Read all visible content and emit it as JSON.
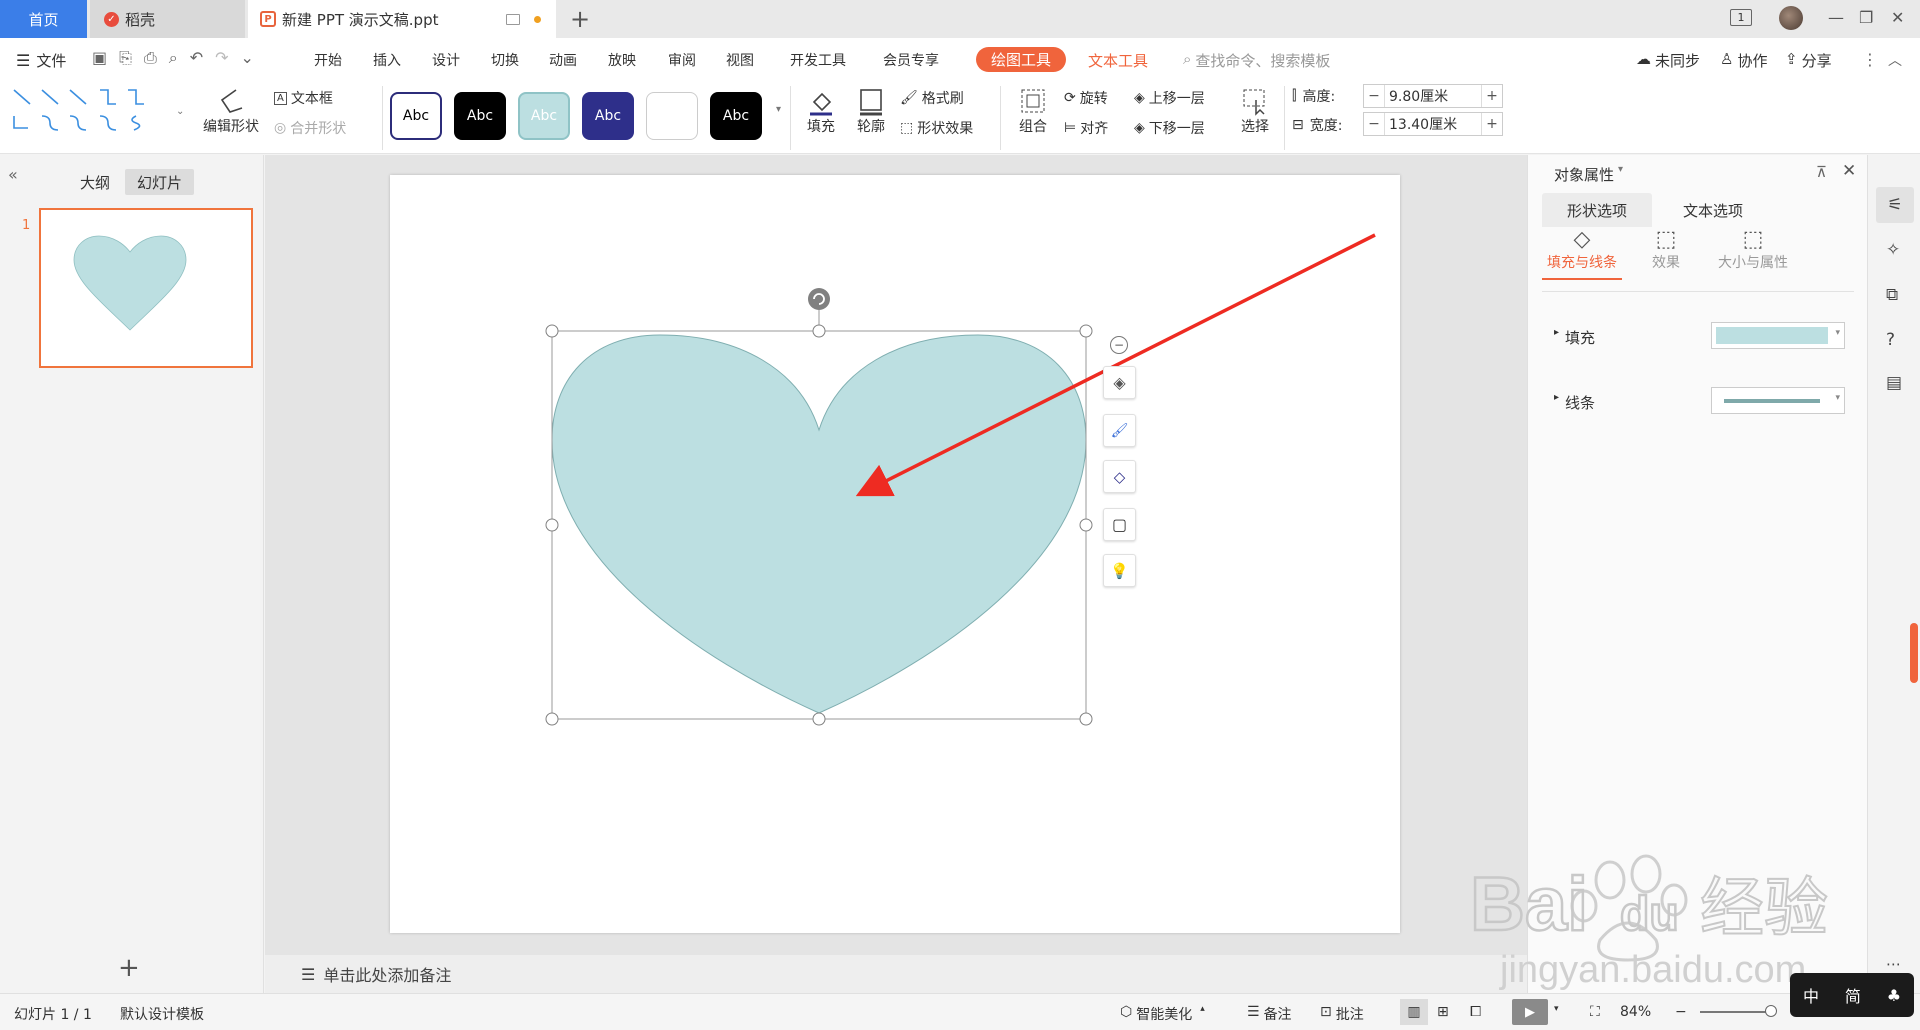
{
  "titlebar": {
    "home_tab": "首页",
    "docer_tab": "稻壳",
    "doc_tab": "新建 PPT 演示文稿.ppt",
    "add_tab": "+",
    "page_badge": "1"
  },
  "menubar": {
    "file": "文件",
    "items": [
      "开始",
      "插入",
      "设计",
      "切换",
      "动画",
      "放映",
      "审阅",
      "视图",
      "开发工具",
      "会员专享"
    ],
    "drawing_tools": "绘图工具",
    "text_tools": "文本工具",
    "search_placeholder": "查找命令、搜索模板",
    "sync": "未同步",
    "collab": "协作",
    "share": "分享"
  },
  "ribbon": {
    "edit_shape": "编辑形状",
    "text_box": "文本框",
    "merge_shape": "合并形状",
    "style_label": "Abc",
    "fill": "填充",
    "outline": "轮廓",
    "format_painter": "格式刷",
    "shape_effect": "形状效果",
    "group": "组合",
    "rotate": "旋转",
    "align": "对齐",
    "bring_forward": "上移一层",
    "send_backward": "下移一层",
    "select": "选择",
    "height_label": "高度:",
    "height_value": "9.80厘米",
    "width_label": "宽度:",
    "width_value": "13.40厘米"
  },
  "leftpanel": {
    "outline_tab": "大纲",
    "slides_tab": "幻灯片",
    "slide_number": "1"
  },
  "canvas": {
    "notes_placeholder": "单击此处添加备注"
  },
  "properties": {
    "title": "对象属性",
    "tab_shape": "形状选项",
    "tab_text": "文本选项",
    "sub_fill_line": "填充与线条",
    "sub_effect": "效果",
    "sub_size": "大小与属性",
    "fill_label": "填充",
    "line_label": "线条"
  },
  "statusbar": {
    "slide_count": "幻灯片 1 / 1",
    "template": "默认设计模板",
    "beautify": "智能美化",
    "notes": "备注",
    "comments": "批注",
    "zoom": "84%"
  },
  "watermark": {
    "brand": "Bai",
    "brand2": "du",
    "cn": "经验",
    "url": "jingyan.baidu.com"
  },
  "ime": {
    "lang": "中",
    "mode": "简"
  },
  "colors": {
    "accent": "#f0643c",
    "heart_fill": "#bcdfe1",
    "heart_stroke": "#7faeb0",
    "annotation_arrow": "#ee2b22",
    "home_tab": "#3b7ee8"
  }
}
